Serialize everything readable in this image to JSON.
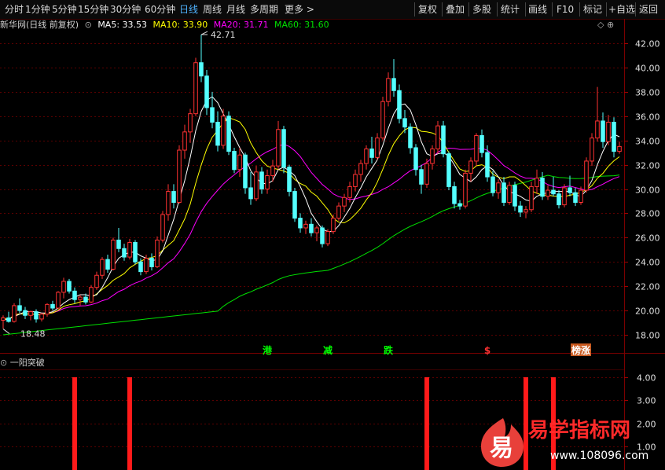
{
  "toolbar": {
    "left_items": [
      "分时",
      "1分钟",
      "5分钟",
      "15分钟",
      "30分钟",
      "60分钟",
      "日线",
      "周线",
      "月线",
      "多周期",
      "更多 >"
    ],
    "active": "日线",
    "right_items": [
      "复权",
      "叠加",
      "多股",
      "统计",
      "画线",
      "F10",
      "标记",
      "+自选",
      "返回"
    ]
  },
  "header": {
    "stock_title": "新华网(日线 前复权)",
    "ma5": "MA5: 33.53",
    "ma10": "MA10: 33.90",
    "ma20": "MA20: 31.71",
    "ma60": "MA60: 31.60",
    "corner_icons": "◇ ⊕"
  },
  "colors": {
    "up": "#ff3232",
    "down": "#54ffff",
    "ma5": "#ffffff",
    "ma10": "#ffff00",
    "ma20": "#ff00ff",
    "ma60": "#00e000",
    "grid": "#5a0000",
    "axis_text": "#e0e0e0"
  },
  "price_axis": {
    "labels": [
      "42.00",
      "40.00",
      "38.00",
      "36.00",
      "34.00",
      "32.00",
      "30.00",
      "28.00",
      "26.00",
      "24.00",
      "22.00",
      "20.00",
      "18.00"
    ]
  },
  "annotations": {
    "high": "42.71",
    "low": "18.48"
  },
  "signals": [
    {
      "text": "港",
      "color": "#00ff00"
    },
    {
      "text": "减",
      "color": "#00ff00"
    },
    {
      "text": "跌",
      "color": "#00ff00"
    },
    {
      "text": "$",
      "color": "#ff3232"
    },
    {
      "text": "榜涨",
      "color": "#ffffff"
    }
  ],
  "indicator": {
    "name": "一阳突破",
    "axis_labels": [
      "4.00",
      "3.00",
      "2.00",
      "1.00"
    ],
    "bar_value": 4
  },
  "watermark": {
    "badge_char": "易",
    "title": "易学指标网",
    "url": "www.108096.com"
  },
  "chart_data": {
    "type": "candlestick",
    "ylim": [
      16.8,
      43.4
    ],
    "high": 42.71,
    "low": 18.48,
    "candles": [
      [
        19.2,
        19.6,
        18.5,
        19.4
      ],
      [
        19.4,
        19.9,
        19.0,
        19.1
      ],
      [
        19.1,
        20.6,
        19.0,
        20.4
      ],
      [
        20.4,
        21.0,
        19.8,
        20.0
      ],
      [
        20.0,
        20.3,
        19.3,
        19.6
      ],
      [
        19.6,
        20.0,
        19.2,
        19.9
      ],
      [
        19.9,
        20.1,
        19.0,
        19.3
      ],
      [
        19.3,
        19.8,
        19.1,
        19.7
      ],
      [
        19.7,
        20.6,
        19.5,
        20.5
      ],
      [
        20.5,
        20.8,
        20.0,
        20.2
      ],
      [
        20.2,
        21.6,
        20.1,
        21.5
      ],
      [
        21.5,
        22.7,
        21.0,
        22.4
      ],
      [
        22.4,
        22.6,
        21.4,
        21.6
      ],
      [
        21.6,
        21.9,
        20.6,
        20.9
      ],
      [
        20.9,
        21.3,
        20.4,
        21.1
      ],
      [
        21.1,
        21.4,
        20.5,
        20.7
      ],
      [
        20.7,
        22.1,
        20.6,
        21.9
      ],
      [
        21.9,
        23.2,
        21.7,
        22.9
      ],
      [
        22.9,
        24.4,
        22.6,
        24.2
      ],
      [
        24.2,
        24.6,
        23.1,
        23.4
      ],
      [
        23.4,
        26.0,
        23.3,
        25.8
      ],
      [
        25.8,
        26.8,
        24.8,
        25.1
      ],
      [
        25.1,
        25.5,
        24.1,
        24.4
      ],
      [
        24.4,
        25.9,
        24.2,
        25.6
      ],
      [
        25.6,
        25.8,
        23.8,
        24.0
      ],
      [
        24.0,
        24.3,
        22.9,
        23.2
      ],
      [
        23.2,
        24.6,
        23.0,
        24.3
      ],
      [
        24.3,
        24.7,
        23.3,
        23.6
      ],
      [
        23.6,
        26.1,
        23.5,
        25.8
      ],
      [
        25.8,
        28.2,
        25.6,
        27.9
      ],
      [
        27.9,
        30.4,
        27.4,
        29.8
      ],
      [
        29.8,
        30.4,
        28.4,
        28.9
      ],
      [
        28.9,
        33.6,
        28.8,
        33.2
      ],
      [
        33.2,
        35.3,
        32.5,
        34.7
      ],
      [
        34.7,
        36.6,
        33.8,
        36.2
      ],
      [
        36.2,
        40.8,
        36.0,
        40.4
      ],
      [
        40.4,
        42.71,
        38.8,
        39.3
      ],
      [
        39.3,
        39.8,
        36.1,
        36.7
      ],
      [
        36.7,
        38.0,
        35.0,
        35.5
      ],
      [
        35.5,
        36.4,
        33.1,
        33.6
      ],
      [
        33.6,
        36.6,
        33.3,
        36.0
      ],
      [
        36.0,
        36.4,
        32.8,
        33.1
      ],
      [
        33.1,
        33.4,
        31.3,
        31.6
      ],
      [
        31.6,
        33.4,
        31.0,
        32.8
      ],
      [
        32.8,
        33.0,
        29.6,
        30.1
      ],
      [
        30.1,
        31.4,
        28.7,
        29.2
      ],
      [
        29.2,
        31.9,
        29.0,
        31.4
      ],
      [
        31.4,
        31.8,
        29.6,
        30.0
      ],
      [
        30.0,
        31.6,
        29.6,
        31.1
      ],
      [
        31.1,
        32.4,
        30.6,
        31.9
      ],
      [
        31.9,
        35.6,
        31.6,
        34.9
      ],
      [
        34.9,
        35.2,
        31.3,
        31.8
      ],
      [
        31.8,
        32.0,
        29.4,
        29.8
      ],
      [
        29.8,
        30.1,
        27.3,
        27.6
      ],
      [
        27.6,
        28.0,
        26.4,
        26.8
      ],
      [
        26.8,
        27.4,
        26.3,
        27.1
      ],
      [
        27.1,
        27.6,
        26.1,
        26.4
      ],
      [
        26.4,
        27.0,
        25.7,
        26.8
      ],
      [
        26.8,
        27.0,
        25.2,
        25.5
      ],
      [
        25.5,
        26.7,
        25.3,
        26.5
      ],
      [
        26.5,
        27.9,
        26.3,
        27.6
      ],
      [
        27.6,
        28.9,
        27.4,
        28.6
      ],
      [
        28.6,
        29.6,
        28.1,
        29.3
      ],
      [
        29.3,
        30.6,
        28.9,
        30.2
      ],
      [
        30.2,
        31.6,
        29.8,
        31.2
      ],
      [
        31.2,
        32.4,
        30.6,
        32.1
      ],
      [
        32.1,
        33.6,
        31.6,
        33.3
      ],
      [
        33.3,
        34.3,
        32.1,
        32.6
      ],
      [
        32.6,
        34.6,
        32.4,
        34.2
      ],
      [
        34.2,
        37.6,
        34.0,
        37.2
      ],
      [
        37.2,
        39.6,
        36.8,
        39.1
      ],
      [
        39.1,
        40.7,
        37.6,
        38.1
      ],
      [
        38.1,
        38.6,
        35.4,
        35.8
      ],
      [
        35.8,
        36.5,
        34.6,
        35.1
      ],
      [
        35.1,
        35.4,
        32.9,
        33.4
      ],
      [
        33.4,
        33.7,
        31.1,
        31.6
      ],
      [
        31.6,
        32.0,
        29.6,
        30.4
      ],
      [
        30.4,
        32.5,
        30.1,
        32.1
      ],
      [
        32.1,
        33.6,
        31.6,
        33.3
      ],
      [
        33.3,
        35.6,
        32.9,
        35.2
      ],
      [
        35.2,
        35.6,
        32.6,
        32.9
      ],
      [
        32.9,
        33.1,
        29.9,
        30.2
      ],
      [
        30.2,
        30.6,
        28.4,
        28.8
      ],
      [
        28.8,
        29.1,
        28.3,
        28.6
      ],
      [
        28.6,
        31.6,
        28.4,
        31.3
      ],
      [
        31.3,
        32.6,
        30.6,
        32.3
      ],
      [
        32.3,
        34.6,
        31.9,
        34.4
      ],
      [
        34.4,
        34.9,
        32.6,
        33.0
      ],
      [
        33.0,
        33.6,
        30.6,
        31.0
      ],
      [
        31.0,
        31.5,
        29.4,
        29.7
      ],
      [
        29.7,
        30.8,
        29.2,
        30.5
      ],
      [
        30.5,
        31.0,
        28.6,
        28.9
      ],
      [
        28.9,
        30.6,
        28.7,
        30.3
      ],
      [
        30.3,
        30.6,
        28.2,
        28.6
      ],
      [
        28.6,
        29.0,
        27.7,
        28.1
      ],
      [
        28.1,
        28.6,
        27.6,
        28.3
      ],
      [
        28.3,
        30.6,
        28.1,
        30.2
      ],
      [
        30.2,
        31.6,
        29.6,
        30.9
      ],
      [
        30.9,
        31.4,
        29.1,
        29.4
      ],
      [
        29.4,
        30.3,
        29.1,
        29.9
      ],
      [
        29.9,
        31.0,
        29.4,
        29.6
      ],
      [
        29.6,
        29.9,
        28.4,
        28.7
      ],
      [
        28.7,
        30.4,
        28.5,
        30.1
      ],
      [
        30.1,
        31.1,
        29.4,
        29.7
      ],
      [
        29.7,
        30.1,
        28.6,
        28.9
      ],
      [
        28.9,
        30.2,
        28.7,
        29.9
      ],
      [
        29.9,
        32.6,
        29.7,
        32.3
      ],
      [
        32.3,
        34.6,
        31.9,
        34.2
      ],
      [
        34.2,
        38.4,
        33.9,
        35.6
      ],
      [
        35.6,
        36.3,
        33.4,
        33.9
      ],
      [
        33.9,
        36.1,
        33.6,
        35.5
      ],
      [
        35.5,
        35.9,
        32.6,
        33.1
      ],
      [
        33.1,
        33.9,
        32.9,
        33.5
      ]
    ],
    "ma5": [
      19.2,
      19.3,
      19.5,
      19.7,
      19.9,
      19.9,
      19.9,
      19.8,
      19.8,
      19.9,
      20.2,
      20.6,
      20.9,
      21.1,
      21.3,
      21.3,
      21.2,
      21.3,
      21.9,
      22.7,
      23.6,
      24.3,
      24.6,
      24.8,
      24.8,
      24.5,
      24.3,
      24.1,
      24.2,
      24.9,
      26.2,
      27.5,
      29.1,
      30.7,
      32.6,
      34.8,
      36.4,
      37.3,
      37.6,
      37.1,
      36.2,
      35.3,
      34.3,
      33.4,
      32.6,
      31.5,
      30.9,
      30.5,
      30.4,
      30.7,
      31.6,
      31.8,
      31.5,
      31.1,
      30.2,
      29.2,
      28.0,
      27.3,
      26.7,
      26.5,
      26.5,
      27.0,
      27.7,
      28.4,
      29.3,
      30.1,
      31.0,
      31.7,
      32.4,
      33.6,
      35.0,
      36.2,
      36.9,
      37.0,
      36.5,
      35.3,
      33.9,
      32.9,
      32.7,
      32.9,
      33.0,
      32.7,
      32.0,
      31.2,
      30.9,
      30.6,
      31.0,
      31.6,
      31.9,
      31.6,
      31.0,
      30.3,
      29.8,
      29.6,
      29.4,
      29.1,
      29.0,
      29.4,
      29.6,
      29.7,
      29.8,
      29.8,
      29.8,
      29.8,
      29.5,
      29.4,
      29.9,
      30.7,
      32.0,
      33.1,
      34.0,
      34.5,
      34.3
    ]
  }
}
